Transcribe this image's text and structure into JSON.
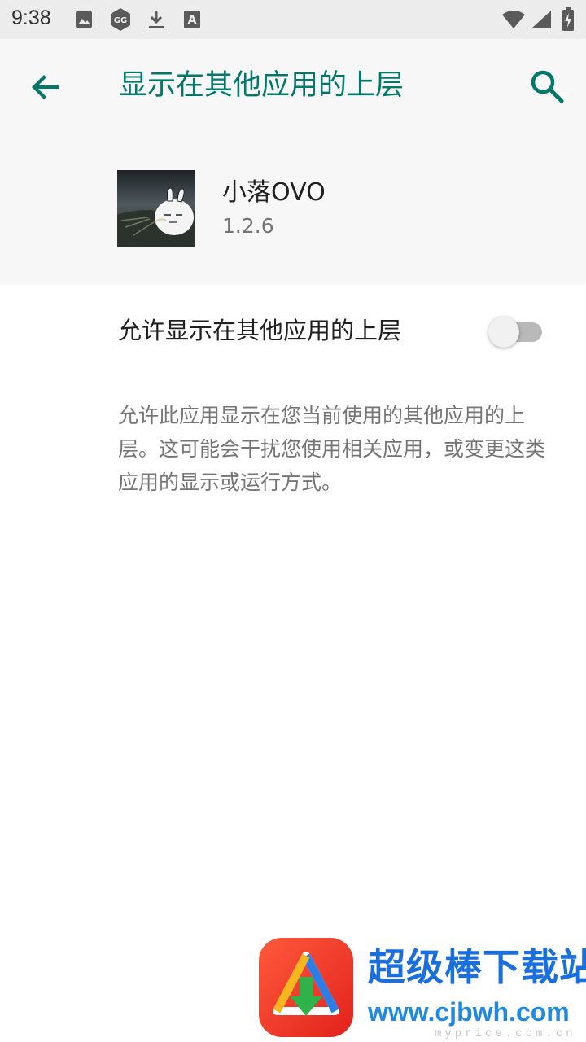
{
  "status_bar": {
    "time": "9:38",
    "icons": [
      "image-icon",
      "game-guardian-icon",
      "download-icon",
      "font-icon",
      "wifi-icon",
      "signal-icon",
      "battery-charging-icon"
    ]
  },
  "header": {
    "title": "显示在其他应用的上层",
    "accent_color": "#00796b"
  },
  "app": {
    "name": "小落OVO",
    "version": "1.2.6"
  },
  "setting": {
    "label": "允许显示在其他应用的上层",
    "enabled": false
  },
  "description": "允许此应用显示在您当前使用的其他应用的上层。这可能会干扰您使用相关应用，或变更这类应用的显示或运行方式。",
  "watermark": {
    "title": "超级棒下载站",
    "url": "www.cjbwh.com",
    "faint_text": "myprice.com.cn"
  }
}
